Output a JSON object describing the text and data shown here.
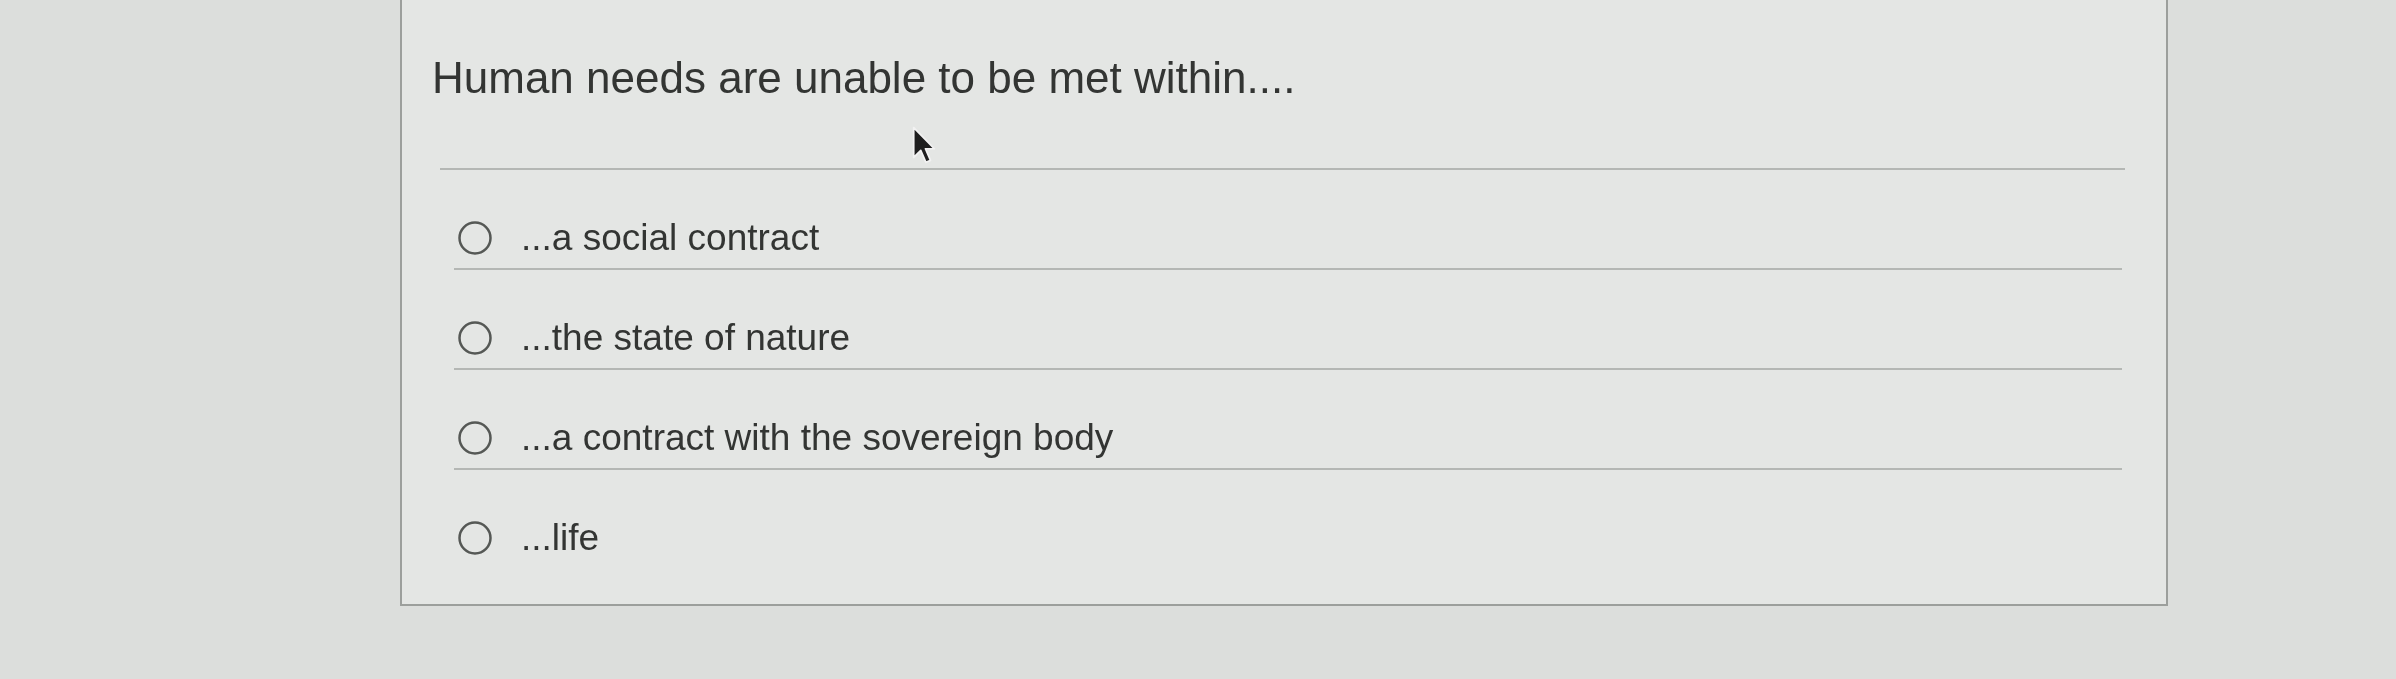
{
  "question": {
    "text": "Human needs are unable to be met within...."
  },
  "options": [
    {
      "label": "...a social contract",
      "selected": false
    },
    {
      "label": "...the state of nature",
      "selected": false
    },
    {
      "label": "...a contract with the sovereign body",
      "selected": false
    },
    {
      "label": "...life",
      "selected": false
    }
  ]
}
